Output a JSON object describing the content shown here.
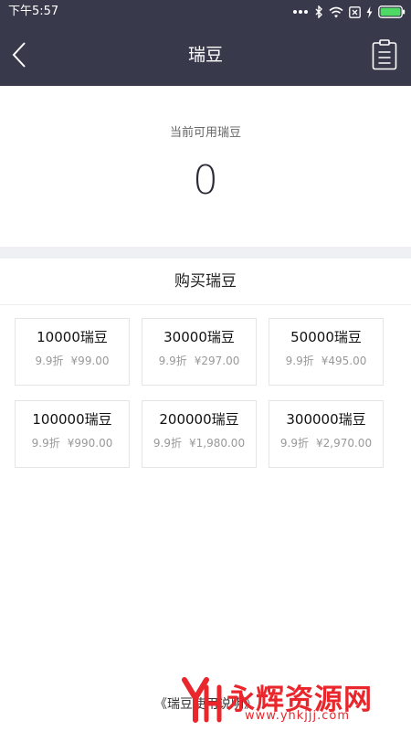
{
  "status_bar": {
    "time": "下午5:57"
  },
  "header": {
    "title": "瑞豆"
  },
  "balance": {
    "label": "当前可用瑞豆",
    "value": "0"
  },
  "purchase": {
    "section_title": "购买瑞豆",
    "packages": [
      {
        "amount": "10000瑞豆",
        "discount": "9.9折",
        "price": "¥99.00"
      },
      {
        "amount": "30000瑞豆",
        "discount": "9.9折",
        "price": "¥297.00"
      },
      {
        "amount": "50000瑞豆",
        "discount": "9.9折",
        "price": "¥495.00"
      },
      {
        "amount": "100000瑞豆",
        "discount": "9.9折",
        "price": "¥990.00"
      },
      {
        "amount": "200000瑞豆",
        "discount": "9.9折",
        "price": "¥1,980.00"
      },
      {
        "amount": "300000瑞豆",
        "discount": "9.9折",
        "price": "¥2,970.00"
      }
    ]
  },
  "footer": {
    "link_text": "《瑞豆使用说明》"
  },
  "watermark": {
    "title": "永辉资源网",
    "url": "www.yhkjjj.com"
  },
  "colors": {
    "header_bg": "#383a4b",
    "page_bg": "#ffffff",
    "divider_bg": "#eef0f3",
    "watermark_red": "#e8262b"
  },
  "icons": [
    "dots-icon",
    "bluetooth-icon",
    "wifi-icon",
    "sim-x-icon",
    "charging-icon",
    "battery-icon",
    "back-chevron-icon",
    "records-clipboard-icon",
    "watermark-logo-icon"
  ]
}
